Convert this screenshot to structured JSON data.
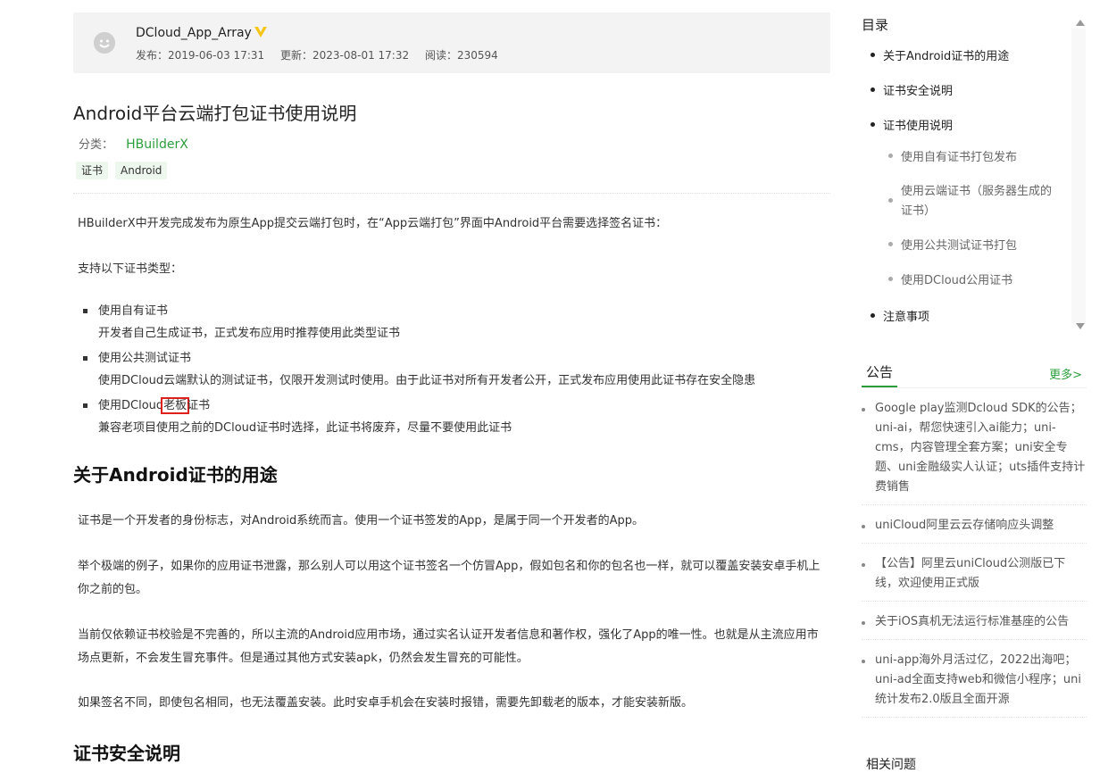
{
  "author": {
    "name": "DCloud_App_Array",
    "published": "发布：2019-06-03 17:31",
    "updated": "更新：2023-08-01 17:32",
    "views": "阅读：230594"
  },
  "article": {
    "title": "Android平台云端打包证书使用说明",
    "category_label": "分类：",
    "category": "HBuilderX",
    "tags": [
      "证书",
      "Android"
    ],
    "intro": "HBuilderX中开发完成发布为原生App提交云端打包时，在“App云端打包”界面中Android平台需要选择签名证书：",
    "types_intro": "支持以下证书类型：",
    "cert_types": [
      {
        "name": "使用自有证书",
        "desc": "开发者自己生成证书，正式发布应用时推荐使用此类型证书"
      },
      {
        "name": "使用公共测试证书",
        "desc": "使用DCloud云端默认的测试证书，仅限开发测试时使用。由于此证书对所有开发者公开，正式发布应用使用此证书存在安全隐患"
      },
      {
        "name_prefix": "使用DCloud",
        "name_highlight": "老板",
        "name_suffix": "证书",
        "desc": "兼容老项目使用之前的DCloud证书时选择，此证书将废弃，尽量不要使用此证书"
      }
    ],
    "section1_title": "关于Android证书的用途",
    "section1_paras": [
      "证书是一个开发者的身份标志，对Android系统而言。使用一个证书签发的App，是属于同一个开发者的App。",
      "举个极端的例子，如果你的应用证书泄露，那么别人可以用这个证书签名一个仿冒App，假如包名和你的包名也一样，就可以覆盖安装安卓手机上你之前的包。",
      "当前仅依赖证书校验是不完善的，所以主流的Android应用市场，通过实名认证开发者信息和著作权，强化了App的唯一性。也就是从主流应用市场点更新，不会发生冒充事件。但是通过其他方式安装apk，仍然会发生冒充的可能性。",
      "如果签名不同，即使包名相同，也无法覆盖安装。此时安卓手机会在安装时报错，需要先卸载老的版本，才能安装新版。"
    ],
    "section2_title": "证书安全说明"
  },
  "toc": {
    "title": "目录",
    "items": [
      {
        "label": "关于Android证书的用途",
        "level": 1
      },
      {
        "label": "证书安全说明",
        "level": 1
      },
      {
        "label": "证书使用说明",
        "level": 1
      },
      {
        "label": "使用自有证书打包发布",
        "level": 2
      },
      {
        "label": "使用云端证书（服务器生成的",
        "label2": "证书）",
        "level": 2
      },
      {
        "label": "使用公共测试证书打包",
        "level": 2
      },
      {
        "label": "使用DCloud公用证书",
        "level": 2
      },
      {
        "label": "注意事项",
        "level": 1
      }
    ]
  },
  "announcements": {
    "title": "公告",
    "more": "更多>",
    "items": [
      "Google play监测Dcloud SDK的公告；uni-ai，帮您快速引入ai能力；uni-cms，内容管理全套方案；uni安全专题、uni金融级实人认证；uts插件支持计费销售",
      "uniCloud阿里云云存储响应头调整",
      "【公告】阿里云uniCloud公测版已下线，欢迎使用正式版",
      "关于iOS真机无法运行标准基座的公告",
      "uni-app海外月活过亿，2022出海吧；uni-ad全面支持web和微信小程序；uni统计发布2.0版且全面开源"
    ]
  },
  "related": {
    "title": "相关问题"
  },
  "colors": {
    "accent": "#2c9d3b",
    "highlight_border": "#e0201a"
  }
}
